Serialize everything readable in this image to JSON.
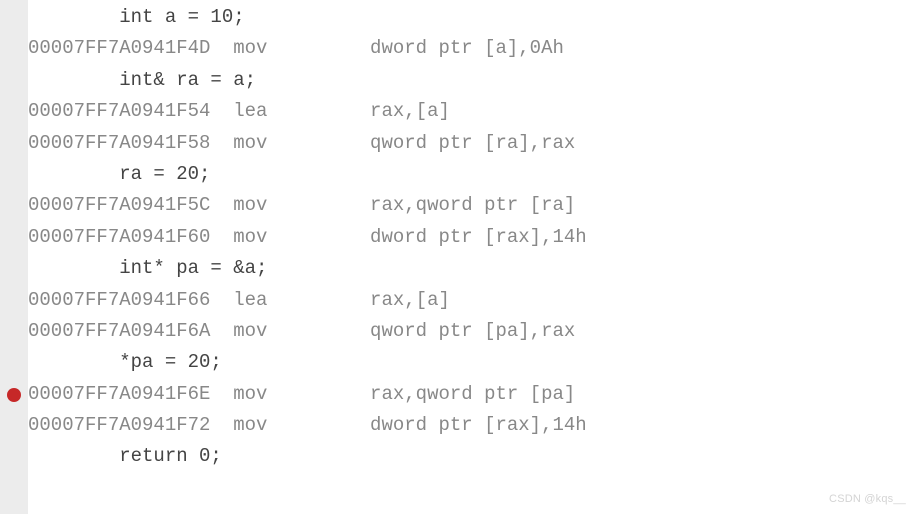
{
  "lines": [
    {
      "kind": "src",
      "indent": "    ",
      "text": "int a = 10;"
    },
    {
      "kind": "asm",
      "addr": "00007FF7A0941F4D",
      "mnem": "mov",
      "ops": "dword ptr [a],0Ah"
    },
    {
      "kind": "src",
      "indent": "    ",
      "text": "int& ra = a;"
    },
    {
      "kind": "asm",
      "addr": "00007FF7A0941F54",
      "mnem": "lea",
      "ops": "rax,[a]"
    },
    {
      "kind": "asm",
      "addr": "00007FF7A0941F58",
      "mnem": "mov",
      "ops": "qword ptr [ra],rax"
    },
    {
      "kind": "src",
      "indent": "    ",
      "text": "ra = 20;"
    },
    {
      "kind": "asm",
      "addr": "00007FF7A0941F5C",
      "mnem": "mov",
      "ops": "rax,qword ptr [ra]"
    },
    {
      "kind": "asm",
      "addr": "00007FF7A0941F60",
      "mnem": "mov",
      "ops": "dword ptr [rax],14h"
    },
    {
      "kind": "src",
      "indent": "    ",
      "text": "int* pa = &a;"
    },
    {
      "kind": "asm",
      "addr": "00007FF7A0941F66",
      "mnem": "lea",
      "ops": "rax,[a]"
    },
    {
      "kind": "asm",
      "addr": "00007FF7A0941F6A",
      "mnem": "mov",
      "ops": "qword ptr [pa],rax"
    },
    {
      "kind": "src",
      "indent": "    ",
      "text": "*pa = 20;"
    },
    {
      "kind": "asm",
      "addr": "00007FF7A0941F6E",
      "mnem": "mov",
      "ops": "rax,qword ptr [pa]",
      "bp": true
    },
    {
      "kind": "asm",
      "addr": "00007FF7A0941F72",
      "mnem": "mov",
      "ops": "dword ptr [rax],14h"
    },
    {
      "kind": "src",
      "indent": "    ",
      "text": "return 0;"
    }
  ],
  "layout": {
    "addr_pad": 18,
    "mnem_pad": 12,
    "src_lead": "    "
  },
  "watermark": "CSDN @kqs__"
}
